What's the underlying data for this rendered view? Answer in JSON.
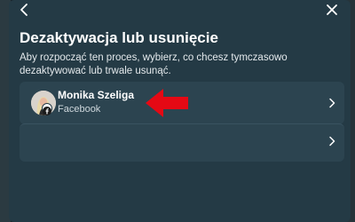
{
  "dialog": {
    "title": "Dezaktywacja lub usunięcie",
    "description": "Aby rozpocząć ten proces, wybierz, co chcesz tymczasowo dezaktywować lub trwale usunąć."
  },
  "accounts": [
    {
      "name": "Monika Szeliga",
      "platform": "Facebook"
    }
  ],
  "icons": {
    "back": "back-arrow-icon",
    "close": "close-icon",
    "chevron": "chevron-right-icon",
    "facebook": "facebook-icon"
  },
  "colors": {
    "dialog_bg": "#243a45",
    "card_bg": "#2c4450",
    "text_primary": "#ffffff",
    "annotation_arrow": "#e50914"
  }
}
